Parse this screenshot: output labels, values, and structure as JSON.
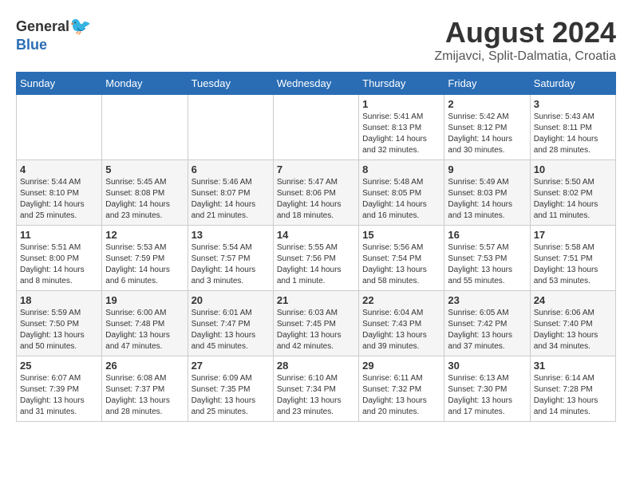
{
  "header": {
    "logo_general": "General",
    "logo_blue": "Blue",
    "month_year": "August 2024",
    "location": "Zmijavci, Split-Dalmatia, Croatia"
  },
  "weekdays": [
    "Sunday",
    "Monday",
    "Tuesday",
    "Wednesday",
    "Thursday",
    "Friday",
    "Saturday"
  ],
  "weeks": [
    [
      {
        "day": "",
        "info": ""
      },
      {
        "day": "",
        "info": ""
      },
      {
        "day": "",
        "info": ""
      },
      {
        "day": "",
        "info": ""
      },
      {
        "day": "1",
        "info": "Sunrise: 5:41 AM\nSunset: 8:13 PM\nDaylight: 14 hours\nand 32 minutes."
      },
      {
        "day": "2",
        "info": "Sunrise: 5:42 AM\nSunset: 8:12 PM\nDaylight: 14 hours\nand 30 minutes."
      },
      {
        "day": "3",
        "info": "Sunrise: 5:43 AM\nSunset: 8:11 PM\nDaylight: 14 hours\nand 28 minutes."
      }
    ],
    [
      {
        "day": "4",
        "info": "Sunrise: 5:44 AM\nSunset: 8:10 PM\nDaylight: 14 hours\nand 25 minutes."
      },
      {
        "day": "5",
        "info": "Sunrise: 5:45 AM\nSunset: 8:08 PM\nDaylight: 14 hours\nand 23 minutes."
      },
      {
        "day": "6",
        "info": "Sunrise: 5:46 AM\nSunset: 8:07 PM\nDaylight: 14 hours\nand 21 minutes."
      },
      {
        "day": "7",
        "info": "Sunrise: 5:47 AM\nSunset: 8:06 PM\nDaylight: 14 hours\nand 18 minutes."
      },
      {
        "day": "8",
        "info": "Sunrise: 5:48 AM\nSunset: 8:05 PM\nDaylight: 14 hours\nand 16 minutes."
      },
      {
        "day": "9",
        "info": "Sunrise: 5:49 AM\nSunset: 8:03 PM\nDaylight: 14 hours\nand 13 minutes."
      },
      {
        "day": "10",
        "info": "Sunrise: 5:50 AM\nSunset: 8:02 PM\nDaylight: 14 hours\nand 11 minutes."
      }
    ],
    [
      {
        "day": "11",
        "info": "Sunrise: 5:51 AM\nSunset: 8:00 PM\nDaylight: 14 hours\nand 8 minutes."
      },
      {
        "day": "12",
        "info": "Sunrise: 5:53 AM\nSunset: 7:59 PM\nDaylight: 14 hours\nand 6 minutes."
      },
      {
        "day": "13",
        "info": "Sunrise: 5:54 AM\nSunset: 7:57 PM\nDaylight: 14 hours\nand 3 minutes."
      },
      {
        "day": "14",
        "info": "Sunrise: 5:55 AM\nSunset: 7:56 PM\nDaylight: 14 hours\nand 1 minute."
      },
      {
        "day": "15",
        "info": "Sunrise: 5:56 AM\nSunset: 7:54 PM\nDaylight: 13 hours\nand 58 minutes."
      },
      {
        "day": "16",
        "info": "Sunrise: 5:57 AM\nSunset: 7:53 PM\nDaylight: 13 hours\nand 55 minutes."
      },
      {
        "day": "17",
        "info": "Sunrise: 5:58 AM\nSunset: 7:51 PM\nDaylight: 13 hours\nand 53 minutes."
      }
    ],
    [
      {
        "day": "18",
        "info": "Sunrise: 5:59 AM\nSunset: 7:50 PM\nDaylight: 13 hours\nand 50 minutes."
      },
      {
        "day": "19",
        "info": "Sunrise: 6:00 AM\nSunset: 7:48 PM\nDaylight: 13 hours\nand 47 minutes."
      },
      {
        "day": "20",
        "info": "Sunrise: 6:01 AM\nSunset: 7:47 PM\nDaylight: 13 hours\nand 45 minutes."
      },
      {
        "day": "21",
        "info": "Sunrise: 6:03 AM\nSunset: 7:45 PM\nDaylight: 13 hours\nand 42 minutes."
      },
      {
        "day": "22",
        "info": "Sunrise: 6:04 AM\nSunset: 7:43 PM\nDaylight: 13 hours\nand 39 minutes."
      },
      {
        "day": "23",
        "info": "Sunrise: 6:05 AM\nSunset: 7:42 PM\nDaylight: 13 hours\nand 37 minutes."
      },
      {
        "day": "24",
        "info": "Sunrise: 6:06 AM\nSunset: 7:40 PM\nDaylight: 13 hours\nand 34 minutes."
      }
    ],
    [
      {
        "day": "25",
        "info": "Sunrise: 6:07 AM\nSunset: 7:39 PM\nDaylight: 13 hours\nand 31 minutes."
      },
      {
        "day": "26",
        "info": "Sunrise: 6:08 AM\nSunset: 7:37 PM\nDaylight: 13 hours\nand 28 minutes."
      },
      {
        "day": "27",
        "info": "Sunrise: 6:09 AM\nSunset: 7:35 PM\nDaylight: 13 hours\nand 25 minutes."
      },
      {
        "day": "28",
        "info": "Sunrise: 6:10 AM\nSunset: 7:34 PM\nDaylight: 13 hours\nand 23 minutes."
      },
      {
        "day": "29",
        "info": "Sunrise: 6:11 AM\nSunset: 7:32 PM\nDaylight: 13 hours\nand 20 minutes."
      },
      {
        "day": "30",
        "info": "Sunrise: 6:13 AM\nSunset: 7:30 PM\nDaylight: 13 hours\nand 17 minutes."
      },
      {
        "day": "31",
        "info": "Sunrise: 6:14 AM\nSunset: 7:28 PM\nDaylight: 13 hours\nand 14 minutes."
      }
    ]
  ]
}
